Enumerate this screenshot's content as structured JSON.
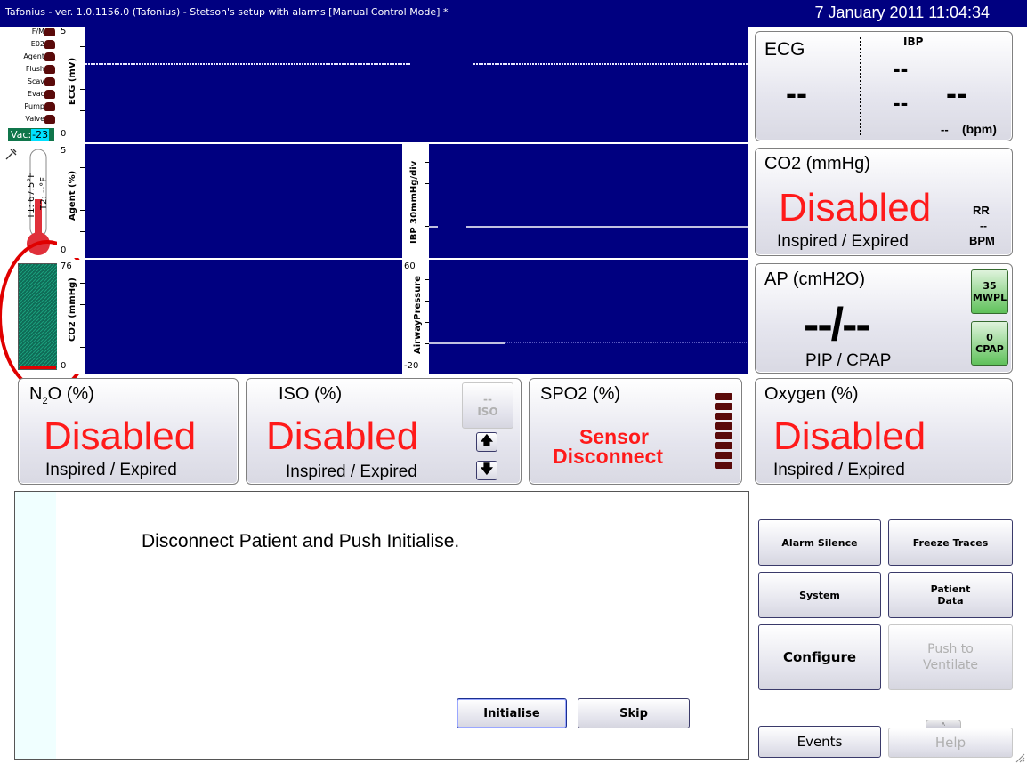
{
  "titlebar": {
    "title": "Tafonius - ver. 1.0.1156.0 (Tafonius) - Stetson's setup with alarms [Manual Control Mode] *",
    "datetime": "7 January 2011 11:04:34"
  },
  "status_flags": [
    "F/M",
    "E02",
    "Agent",
    "Flush",
    "Scav",
    "Evac",
    "Pump",
    "Valve"
  ],
  "vac": {
    "label": "Vac:",
    "value": "-23"
  },
  "thermometer": {
    "t1": "T1: 67.5°F",
    "t2": "T2: --°F"
  },
  "co2_bar": {
    "max": "76",
    "min": "0",
    "level_fraction": 0.03
  },
  "plots": {
    "ecg": {
      "ylabel": "ECG (mV)",
      "top": "5",
      "bottom": "0"
    },
    "agent": {
      "ylabel": "Agent (%)",
      "top": "5",
      "bottom": "0"
    },
    "ibp": {
      "ylabel": "IBP 30mmHg/div"
    },
    "co2": {
      "ylabel": "CO2 (mmHg)",
      "top": "76",
      "bottom": "0"
    },
    "airway": {
      "ylabel": "AirwayPressure",
      "top": "60",
      "bottom": "-20"
    }
  },
  "panels": {
    "ecg": {
      "title": "ECG",
      "value": "--"
    },
    "ibp": {
      "title": "IBP",
      "top": "--",
      "mid": "--",
      "bottom": "--",
      "hr": "--",
      "hr_unit": "(bpm)"
    },
    "co2": {
      "title": "CO2 (mmHg)",
      "value": "Disabled",
      "sub": "Inspired / Expired",
      "rr_label": "RR",
      "rr_value": "--",
      "rr_unit": "BPM"
    },
    "ap": {
      "title": "AP (cmH2O)",
      "value": "--/--",
      "sub": "PIP / CPAP",
      "mwpl_value": "35",
      "mwpl_label": "MWPL",
      "cpap_value": "0",
      "cpap_label": "CPAP"
    },
    "n2o": {
      "title_pre": "N",
      "title_sub": "2",
      "title_post": "O (%)",
      "value": "Disabled",
      "sub": "Inspired / Expired"
    },
    "iso": {
      "title": "ISO (%)",
      "value": "Disabled",
      "sub": "Inspired / Expired",
      "ctrl_value": "--",
      "ctrl_label": "ISO"
    },
    "spo2": {
      "title": "SPO2 (%)",
      "line1": "Sensor",
      "line2": "Disconnect"
    },
    "oxygen": {
      "title": "Oxygen (%)",
      "value": "Disabled",
      "sub": "Inspired / Expired"
    }
  },
  "message": {
    "text": "Disconnect Patient and Push Initialise.",
    "initialise": "Initialise",
    "skip": "Skip"
  },
  "buttons": {
    "alarm_silence": "Alarm Silence",
    "freeze_traces": "Freeze Traces",
    "system": "System",
    "patient_data_1": "Patient",
    "patient_data_2": "Data",
    "configure": "Configure",
    "push_ventilate_1": "Push to",
    "push_ventilate_2": "Ventilate",
    "events": "Events",
    "help": "Help"
  },
  "colors": {
    "plot_bg": "#000080",
    "alarm_red": "#ff1a1a",
    "panel_bg": "#e5e5ee",
    "annotation_red": "#e00000",
    "green_button": "#5fc15a"
  }
}
